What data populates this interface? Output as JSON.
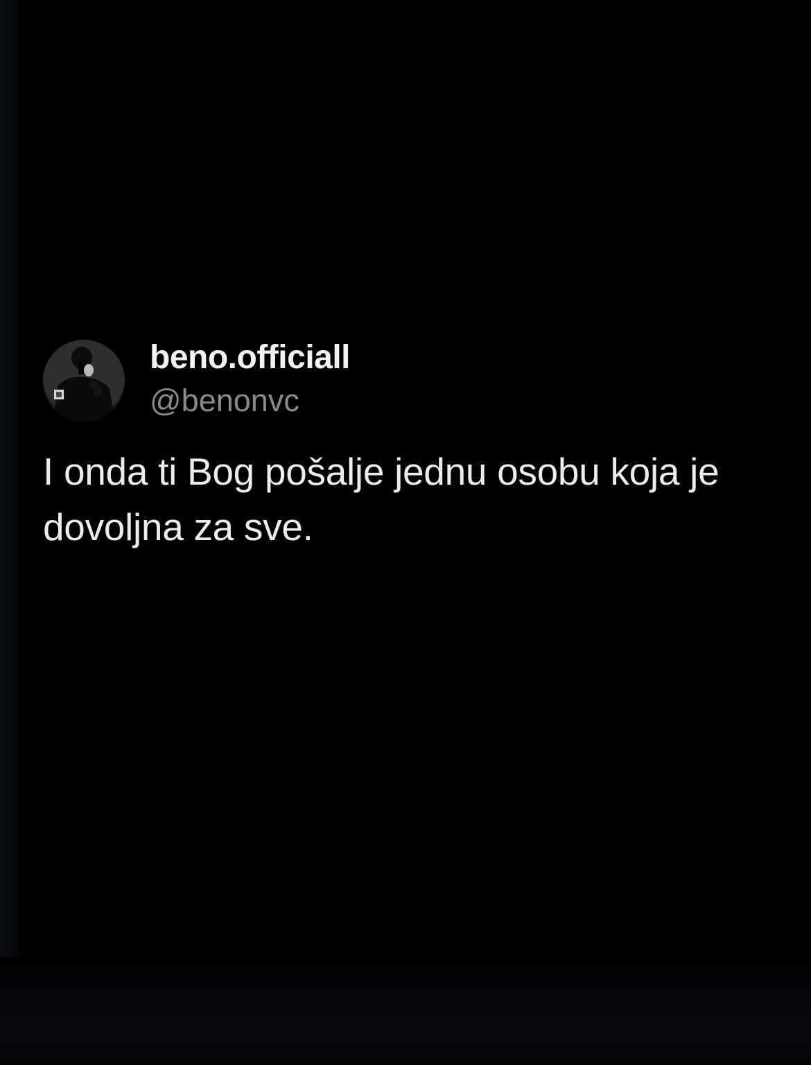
{
  "post": {
    "display_name": "beno.officiall",
    "handle": "@benonvc",
    "text": "I onda ti Bog pošalje jednu osobu koja je dovoljna za sve."
  },
  "colors": {
    "background": "#000000",
    "name": "#f2f2f2",
    "handle": "#8a8a8a",
    "text": "#ececec"
  },
  "icons": {
    "avatar": "profile-photo-avatar"
  }
}
